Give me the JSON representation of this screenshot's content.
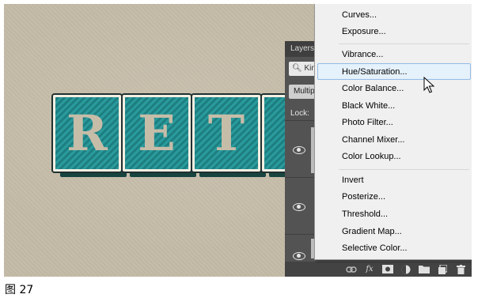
{
  "canvas": {
    "artwork_text": "RETRO"
  },
  "layers_panel": {
    "title": "Layers",
    "filter_value": "Kin",
    "blend_value": "Multip",
    "lock_label": "Lock:"
  },
  "adjustment_menu": {
    "items_group1": [
      "Curves...",
      "Exposure..."
    ],
    "items_group2": [
      "Vibrance...",
      "Hue/Saturation...",
      "Color Balance...",
      "Black  White...",
      "Photo Filter...",
      "Channel Mixer...",
      "Color Lookup..."
    ],
    "items_group3": [
      "Invert",
      "Posterize...",
      "Threshold...",
      "Gradient Map...",
      "Selective Color..."
    ],
    "highlighted": "Hue/Saturation..."
  },
  "bottom_bar_icons": [
    "link-icon",
    "fx-icon",
    "mask-icon",
    "adjustment-icon",
    "folder-icon",
    "new-layer-icon",
    "trash-icon"
  ],
  "bottom_bar": {
    "fx_label": "fx"
  },
  "caption": "图 27",
  "colors": {
    "teal": "#2a9a9c",
    "panel": "#535353",
    "menu_bg": "#f0f0f0",
    "highlight": "#e5f1fb"
  }
}
